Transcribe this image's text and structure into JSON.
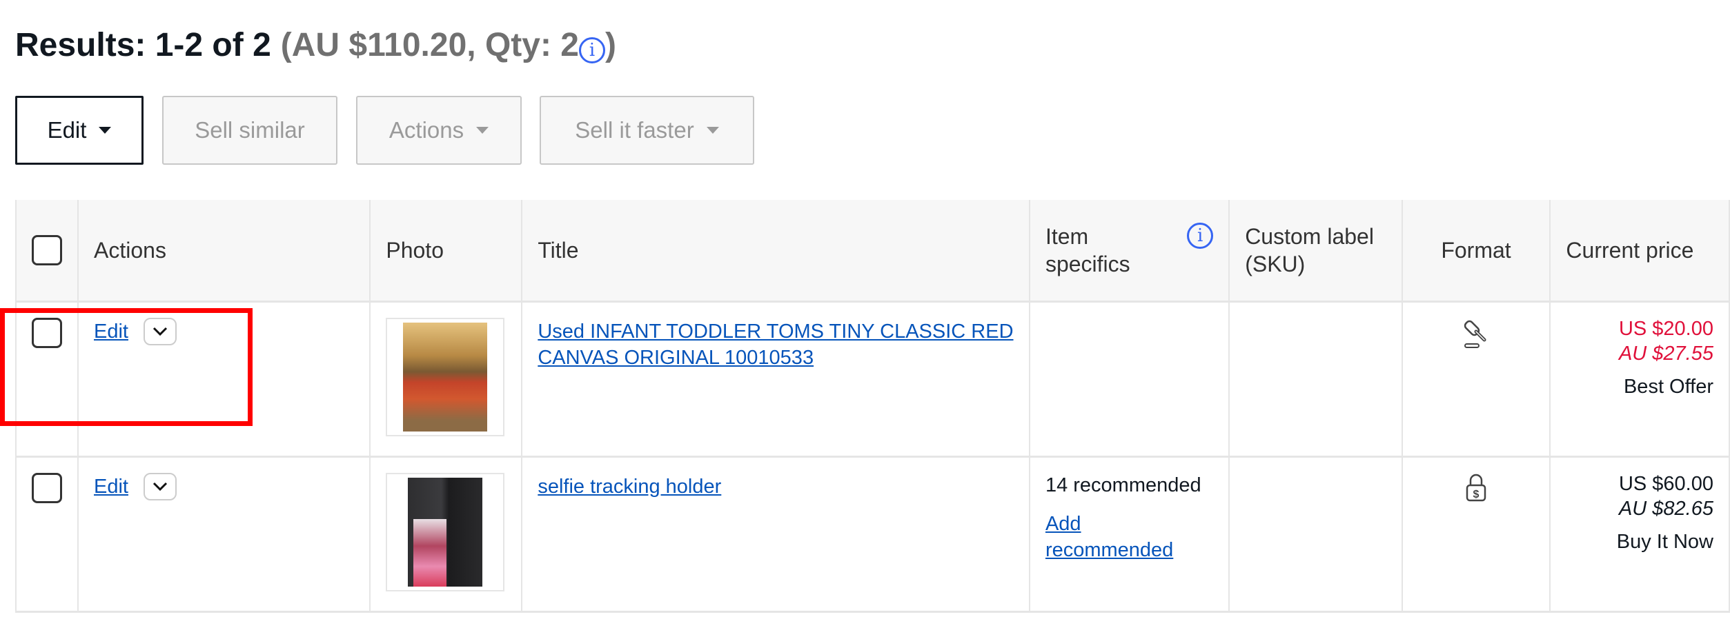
{
  "results": {
    "label": "Results: 1-2 of 2",
    "summary_open": "(AU $110.20, Qty: 2",
    "summary_close": ")",
    "info_icon": "info-circle-icon"
  },
  "toolbar": {
    "edit_label": "Edit",
    "sell_similar_label": "Sell similar",
    "actions_label": "Actions",
    "sell_faster_label": "Sell it faster"
  },
  "table": {
    "headers": {
      "actions": "Actions",
      "photo": "Photo",
      "title": "Title",
      "item_specifics": "Item specifics",
      "custom_label": "Custom label (SKU)",
      "format": "Format",
      "current_price": "Current price"
    },
    "rows": [
      {
        "edit": "Edit",
        "title": "Used INFANT TODDLER TOMS TINY CLASSIC RED CANVAS ORIGINAL 10010533",
        "item_specifics": "",
        "add_recommended": "",
        "custom_label": "",
        "format_icon": "auction-gavel-icon",
        "price_us": "US $20.00",
        "price_au": "AU $27.55",
        "price_type": "Best Offer",
        "price_color": "#e0103a"
      },
      {
        "edit": "Edit",
        "title": "selfie tracking holder",
        "item_specifics": "14 recommended",
        "add_recommended": "Add recommended",
        "custom_label": "",
        "format_icon": "fixed-price-lock-icon",
        "price_us": "US $60.00",
        "price_au": "AU $82.65",
        "price_type": "Buy It Now",
        "price_color": "#111820"
      }
    ]
  },
  "colors": {
    "link": "#0654ba",
    "info": "#3665f3",
    "highlight": "#ff0000"
  }
}
